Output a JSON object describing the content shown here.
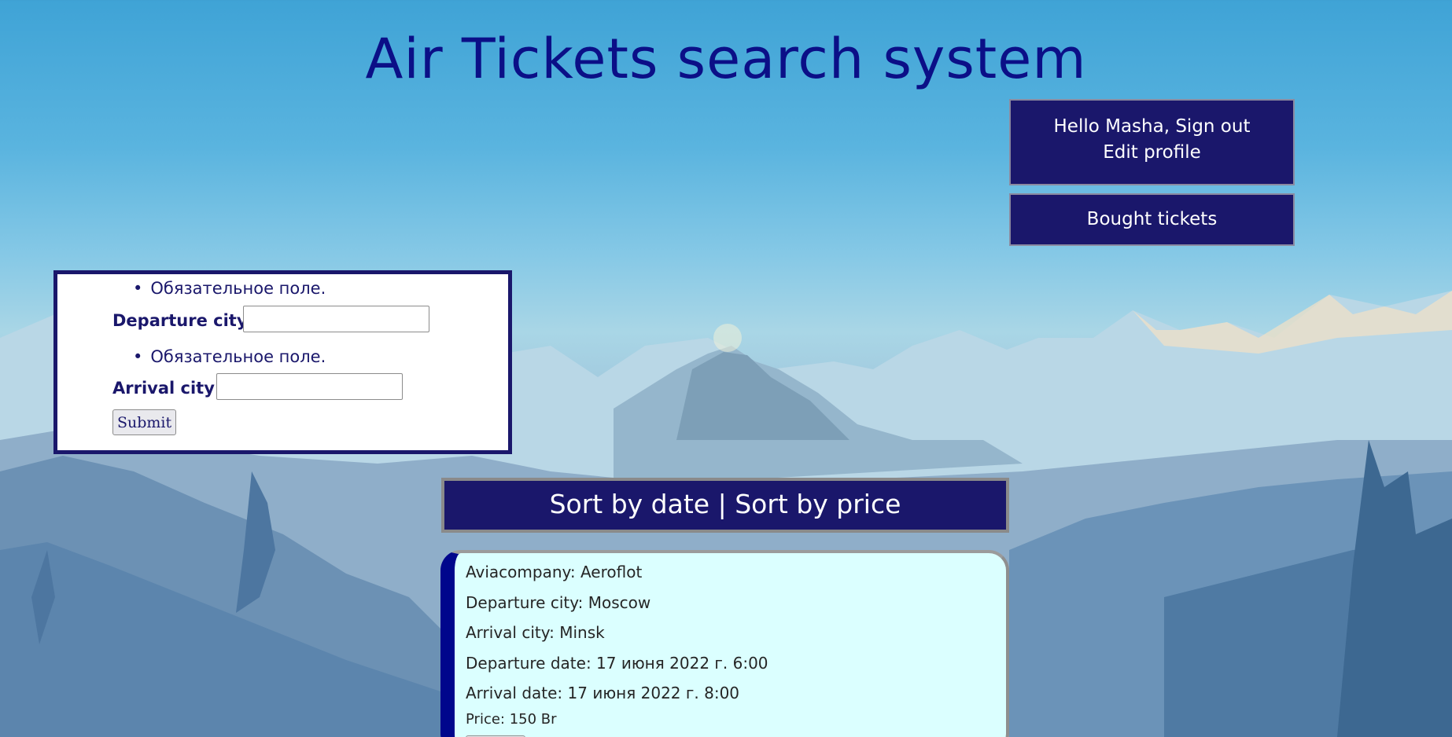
{
  "header": {
    "title": "Air Tickets search system"
  },
  "user_menu": {
    "greeting": "Hello Masha, ",
    "sign_out": "Sign out",
    "edit_profile": "Edit profile",
    "bought_tickets": "Bought tickets"
  },
  "search_form": {
    "departure_error": "Обязательное поле.",
    "departure_label": "Departure city:",
    "departure_value": "",
    "arrival_error": "Обязательное поле.",
    "arrival_label": "Arrival city:",
    "arrival_value": "",
    "submit_label": "Submit"
  },
  "sort": {
    "by_date": "Sort by date",
    "separator": " | ",
    "by_price": "Sort by price"
  },
  "tickets": [
    {
      "company": "Aviacompany: Aeroflot",
      "departure_city": "Departure city: Moscow",
      "arrival_city": "Arrival city: Minsk",
      "departure_date": "Departure date: 17 июня 2022 г. 6:00",
      "arrival_date": "Arrival date: 17 июня 2022 г. 8:00",
      "price": "Price: 150 Br"
    }
  ],
  "colors": {
    "accent": "#1a176b",
    "title": "#0b0f87",
    "card_bg": "#dbffff",
    "card_border_left": "#00068c"
  }
}
